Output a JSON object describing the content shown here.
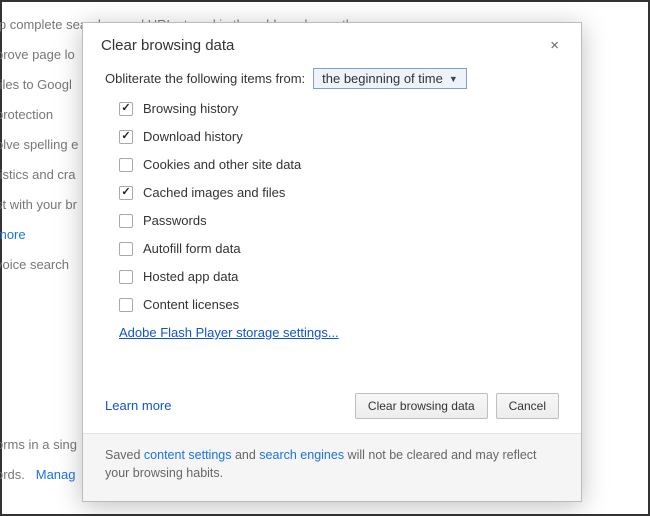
{
  "background": {
    "lines": [
      "ip complete searches and URLs typed in the address bar or the app",
      "prove page lo",
      "files to Googl",
      "   protection",
      "olve spelling e",
      "tistics and cra",
      "st with your br",
      "more",
      "voice search",
      "",
      "",
      "",
      "",
      "",
      "orms in a sing",
      "ords.   Manag"
    ]
  },
  "dialog": {
    "title": "Clear browsing data",
    "close": "×",
    "obliterate_label": "Obliterate the following items from:",
    "time_range_selected": "the beginning of time",
    "items": [
      {
        "label": "Browsing history",
        "checked": true
      },
      {
        "label": "Download history",
        "checked": true
      },
      {
        "label": "Cookies and other site data",
        "checked": false
      },
      {
        "label": "Cached images and files",
        "checked": true
      },
      {
        "label": "Passwords",
        "checked": false
      },
      {
        "label": "Autofill form data",
        "checked": false
      },
      {
        "label": "Hosted app data",
        "checked": false
      },
      {
        "label": "Content licenses",
        "checked": false
      }
    ],
    "flash_link": "Adobe Flash Player storage settings...",
    "learn_more": "Learn more",
    "primary_button": "Clear browsing data",
    "cancel_button": "Cancel",
    "footer_pre": "Saved ",
    "footer_link1": "content settings",
    "footer_mid": " and ",
    "footer_link2": "search engines",
    "footer_post": " will not be cleared and may reflect your browsing habits."
  }
}
